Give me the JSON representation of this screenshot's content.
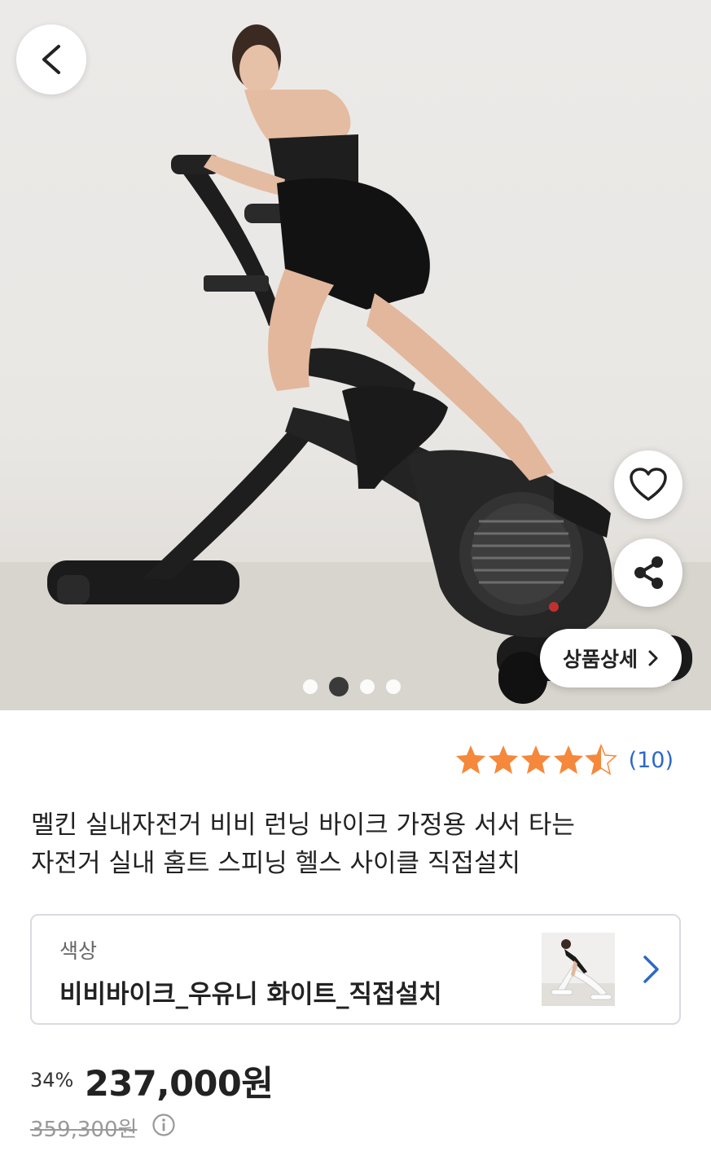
{
  "gallery": {
    "image_alt": "",
    "icons": {
      "back": "chevron-left-icon",
      "like": "heart-outline-icon",
      "share": "share-icon",
      "detail_chevron": "chevron-right-icon"
    },
    "detail_button_label": "상품상세",
    "total_slides": 4,
    "current_slide": 2
  },
  "rating": {
    "score": 4.5,
    "max": 5,
    "review_count_label": "(10)",
    "star_color": "#f5883a"
  },
  "product": {
    "title_line1": "멜킨 실내자전거 비비 런닝 바이크 가정용 서서 타는",
    "title_line2": "자전거 실내 홈트 스피닝 헬스 사이클 직접설치"
  },
  "option": {
    "label": "색상",
    "value": "비비바이크_우유니 화이트_직접설치"
  },
  "pricing": {
    "discount": "34%",
    "price": "237,000원",
    "original_price": "359,300원"
  },
  "colors": {
    "accent_blue": "#2d68c8"
  }
}
